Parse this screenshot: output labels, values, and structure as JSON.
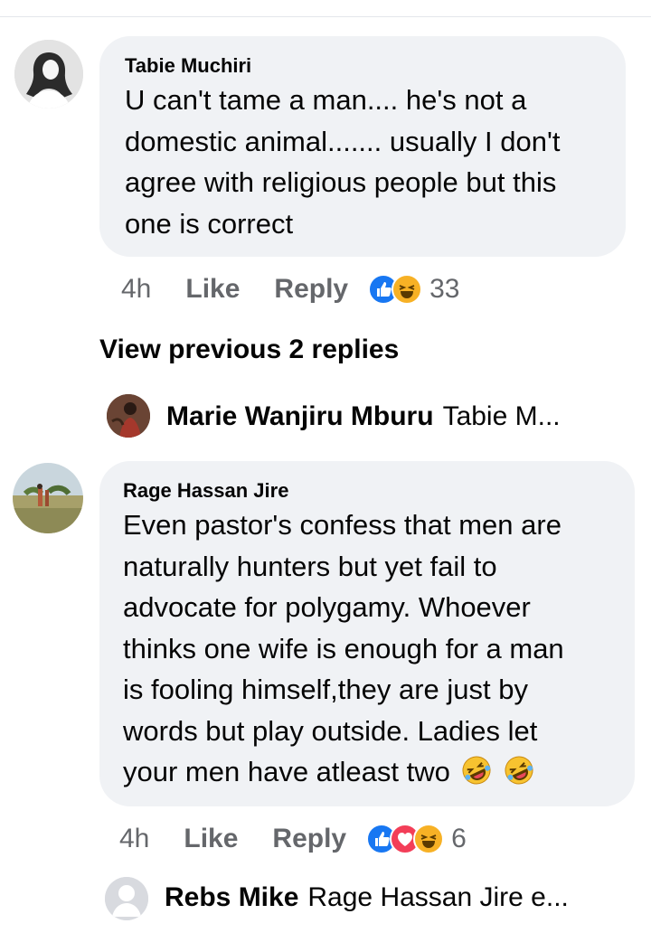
{
  "comments": [
    {
      "author": "Tabie Muchiri",
      "lines": [
        "U can't tame a man.... he's not a",
        "domestic animal....... usually I don't",
        "agree with religious people but this",
        "one is correct"
      ],
      "time": "4h",
      "like_label": "Like",
      "reply_label": "Reply",
      "reactions": [
        "like",
        "haha"
      ],
      "reaction_count": "33"
    },
    {
      "author": "Rage Hassan Jire",
      "lines": [
        "Even pastor's confess that men are",
        "naturally hunters but yet fail to",
        "advocate for polygamy. Whoever",
        "thinks one wife is enough for a man",
        "is fooling himself,they are just by",
        "words but  play outside. Ladies let",
        "your men have atleast two"
      ],
      "trailing_emojis": [
        "rolling-on-floor-laughing",
        "rolling-on-floor-laughing"
      ],
      "time": "4h",
      "like_label": "Like",
      "reply_label": "Reply",
      "reactions": [
        "like",
        "love",
        "haha"
      ],
      "reaction_count": "6"
    }
  ],
  "view_previous": "View previous 2 replies",
  "replies": [
    {
      "name": "Marie Wanjiru Mburu",
      "preview": "Tabie M..."
    },
    {
      "name": "Rebs Mike",
      "preview": "Rage Hassan Jire e..."
    }
  ],
  "colors": {
    "bubble": "#f0f2f5",
    "secondary_text": "#65676b",
    "like_blue": "#1877f2",
    "love_red": "#f33e58",
    "haha_yellow": "#f7b125"
  }
}
